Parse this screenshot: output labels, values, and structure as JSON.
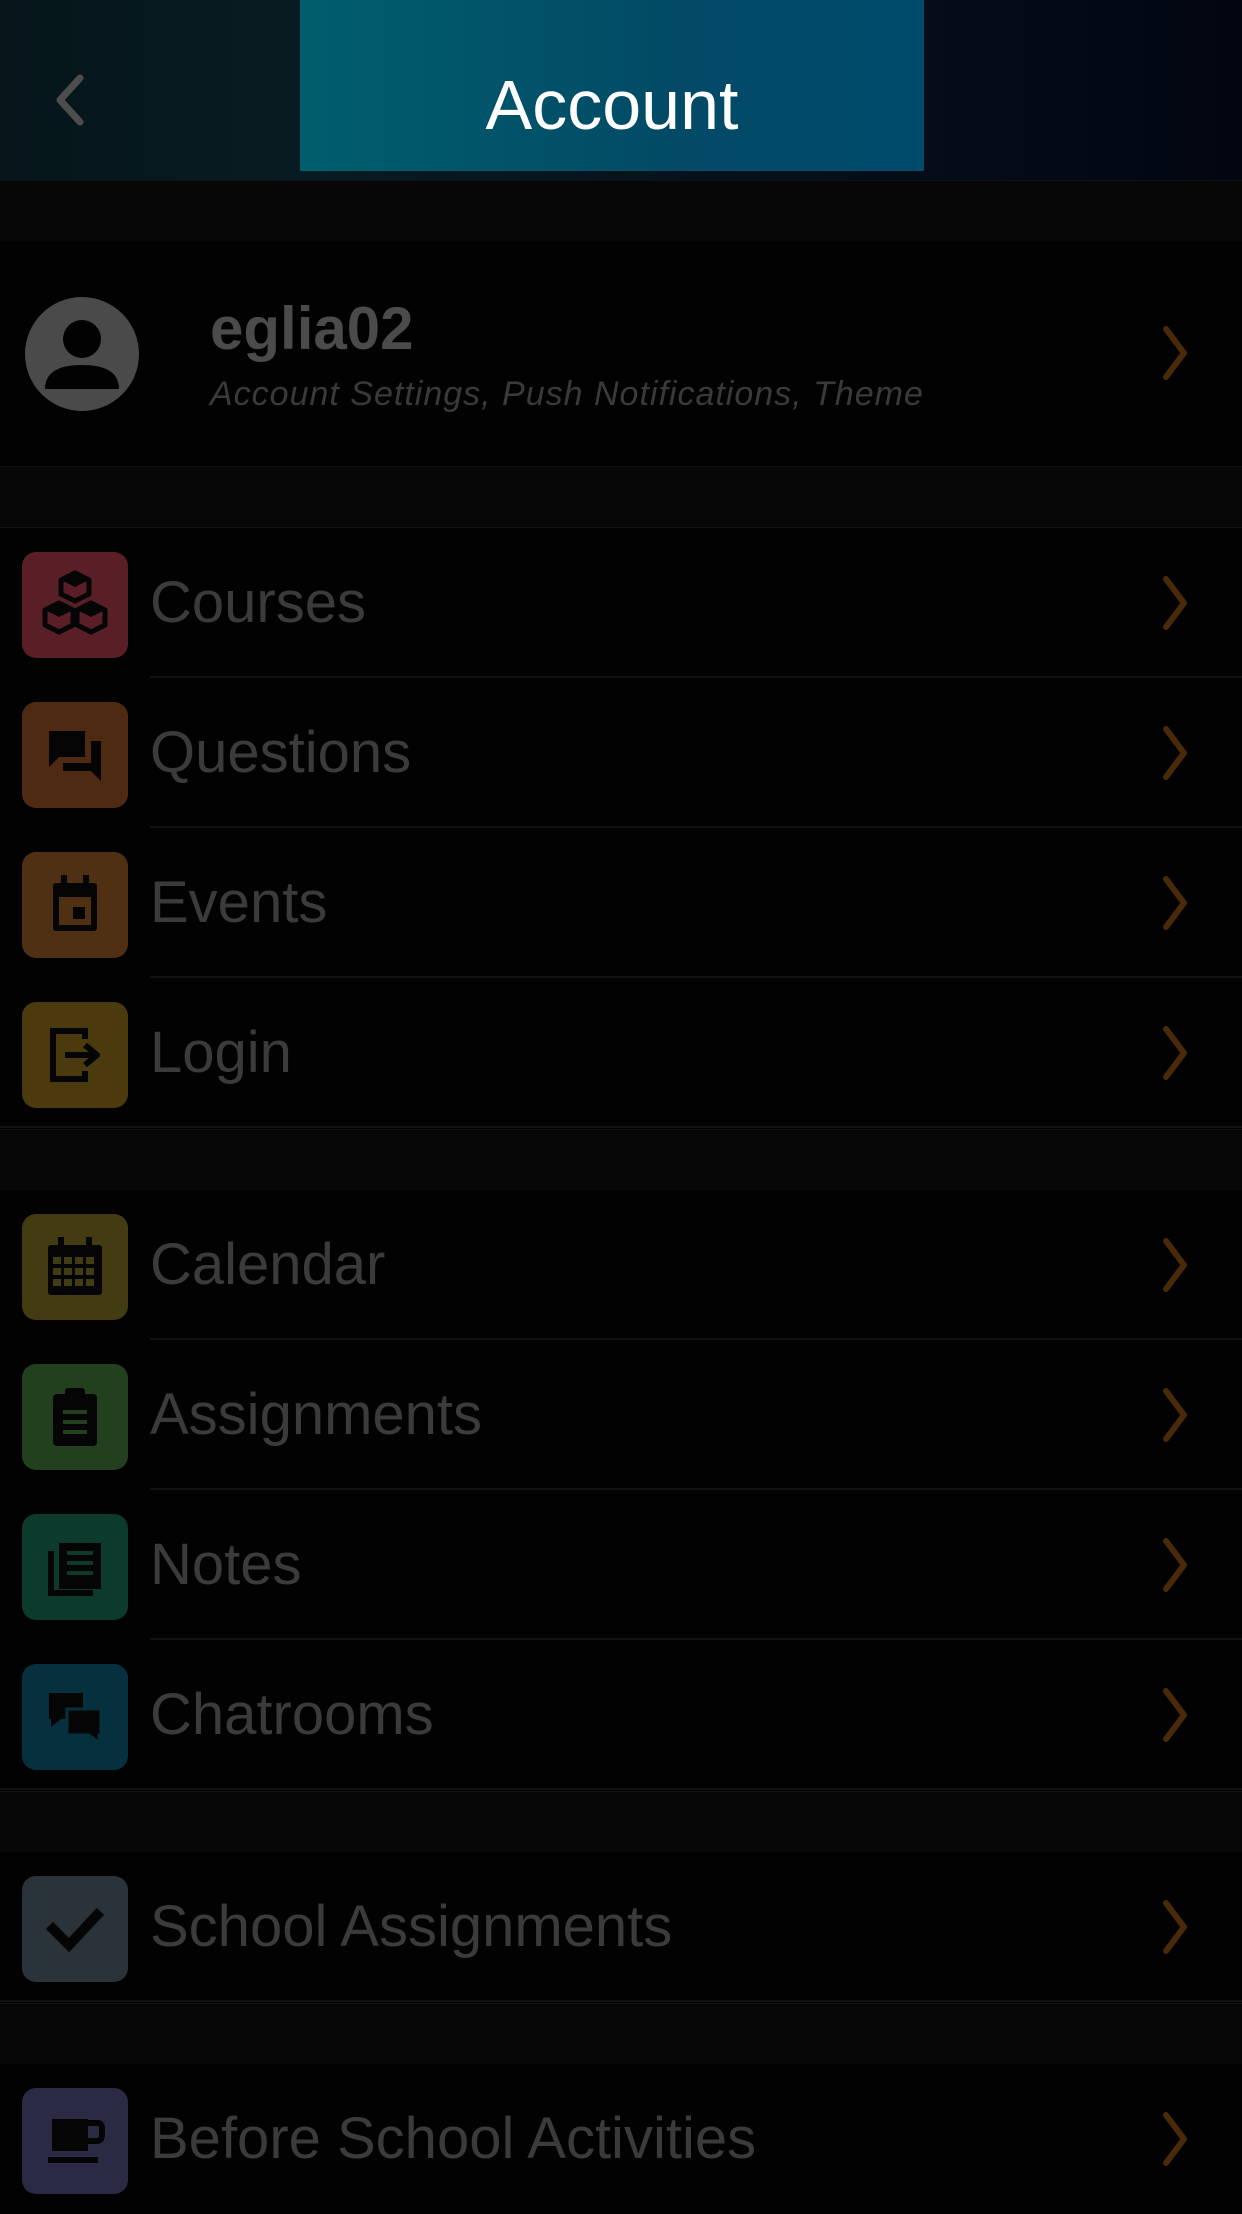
{
  "nav": {
    "title": "Account",
    "back_icon": "chevron-left-icon"
  },
  "profile": {
    "username": "eglia02",
    "subtitle": "Account Settings, Push Notifications, Theme"
  },
  "colors": {
    "accent_chevron": "#4a2a08",
    "courses": "#5a1e26",
    "questions": "#4e2a12",
    "events": "#4f3012",
    "login": "#4a3a0e",
    "calendar": "#433b12",
    "assignments": "#22401e",
    "notes": "#0c3a2c",
    "chatrooms": "#06303e",
    "school_assignments": "#2a323a",
    "before_school": "#2a2a44"
  },
  "menu": {
    "courses": "Courses",
    "questions": "Questions",
    "events": "Events",
    "login": "Login",
    "calendar": "Calendar",
    "assignments": "Assignments",
    "notes": "Notes",
    "chatrooms": "Chatrooms",
    "school_assignments": "School Assignments",
    "before_school": "Before School Activities"
  }
}
